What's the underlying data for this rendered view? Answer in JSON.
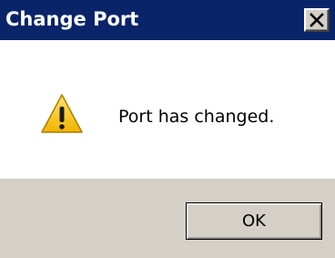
{
  "dialog": {
    "title": "Change Port",
    "message": "Port has changed.",
    "ok_label": "OK",
    "close_icon": "close-icon",
    "message_icon": "warning-icon"
  },
  "colors": {
    "titlebar": "#0a246a",
    "title_text": "#ffffff",
    "content_bg": "#ffffff",
    "footer_bg": "#d4d0c8",
    "warning_yellow": "#f5c518"
  }
}
